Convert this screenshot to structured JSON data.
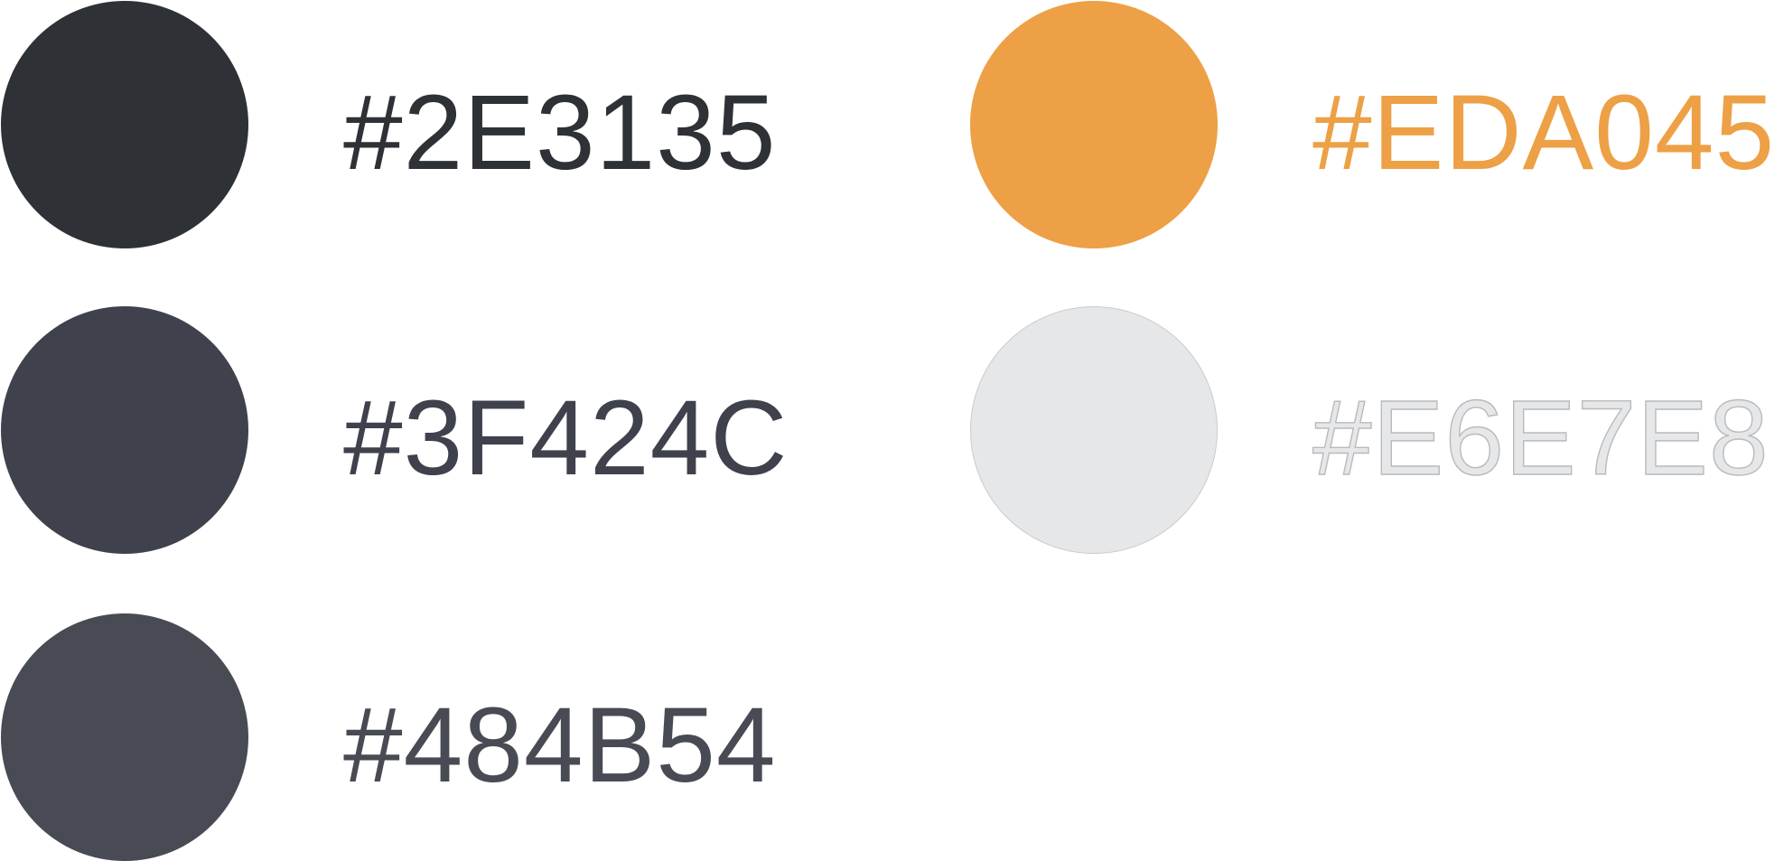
{
  "swatches": [
    {
      "id": "2e3135",
      "hex_label": "#2E3135",
      "color": "#2E3135"
    },
    {
      "id": "3f424c",
      "hex_label": "#3F424C",
      "color": "#3F424C"
    },
    {
      "id": "484b54",
      "hex_label": "#484B54",
      "color": "#484B54"
    },
    {
      "id": "eda045",
      "hex_label": "#EDA045",
      "color": "#EDA045"
    },
    {
      "id": "e6e7e8",
      "hex_label": "#E6E7E8",
      "color": "#E6E7E8"
    }
  ]
}
